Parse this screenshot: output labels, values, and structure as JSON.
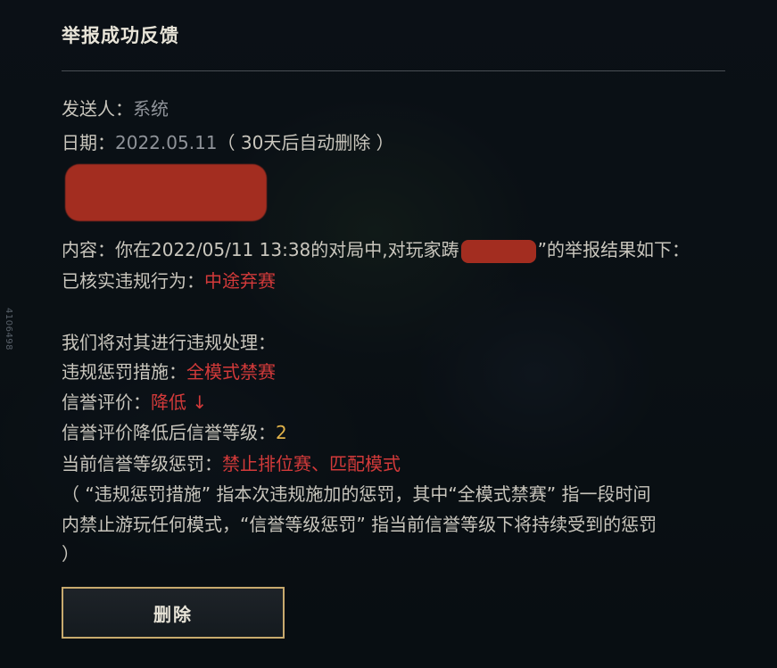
{
  "side_id": "4106498",
  "dialog": {
    "title": "举报成功反馈",
    "sender_label": "发送人：",
    "sender_value": "系统",
    "date_label": "日期：",
    "date_value": "2022.05.11",
    "date_note": "（ 30天后自动删除 ）",
    "content_prefix": "内容：你在2022/05/11 13:38的对局中,对玩家",
    "content_player_first_char": "踌",
    "content_player_quote_end": "”",
    "content_suffix": "的举报结果如下：",
    "verified_label": "已核实违规行为：",
    "verified_value": "中途弃赛",
    "handling_line": "我们将对其进行违规处理：",
    "penalty_label": "违规惩罚措施：",
    "penalty_value": "全模式禁赛",
    "credit_label": "信誉评价：",
    "credit_value": "降低 ↓",
    "credit_level_label": "信誉评价降低后信誉等级：",
    "credit_level_value": "2",
    "current_penalty_label": "当前信誉等级惩罚：",
    "current_penalty_value": "禁止排位赛、匹配模式",
    "note_line1": "（ “违规惩罚措施” 指本次违规施加的惩罚，其中“全模式禁赛” 指一段时间",
    "note_line2": "内禁止游玩任何模式，“信誉等级惩罚” 指当前信誉等级下将持续受到的惩罚",
    "note_line3": "）",
    "delete_label": "删除"
  },
  "colors": {
    "accent_red": "#d33a3a",
    "accent_gold": "#e0b24a",
    "button_border": "#c8aa6e"
  }
}
